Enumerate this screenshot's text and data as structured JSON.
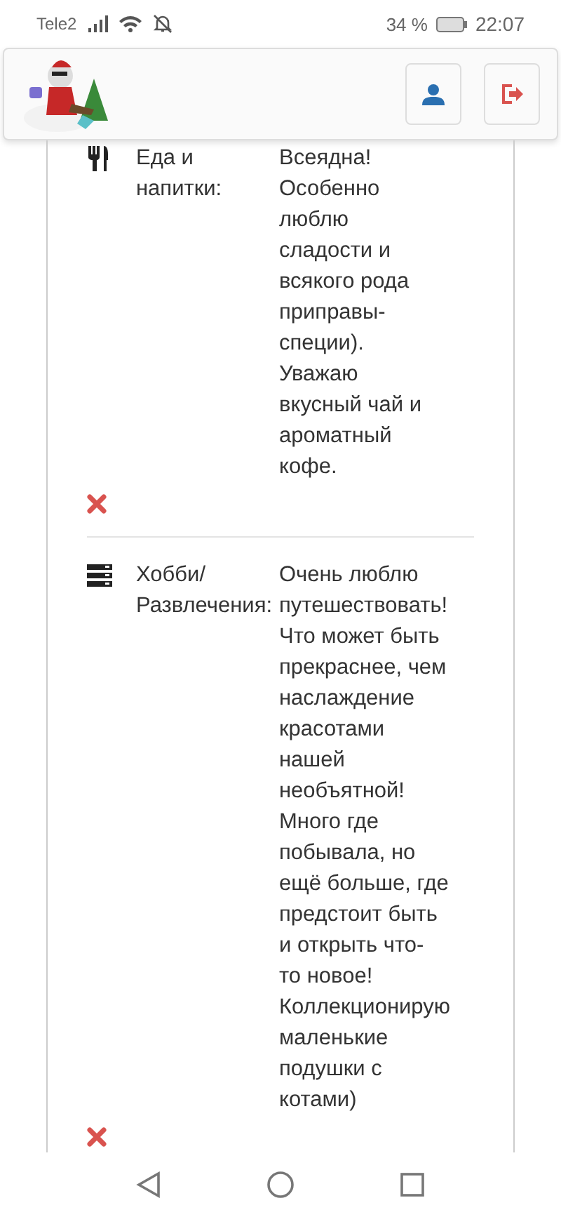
{
  "status_bar": {
    "carrier": "Tele2",
    "battery": "34 %",
    "time": "22:07"
  },
  "header": {
    "buttons": [
      {
        "kind": "profile"
      },
      {
        "kind": "logout"
      }
    ]
  },
  "entries": [
    {
      "kind": "food",
      "label": "Еда и\nнапитки:",
      "text": "Всеядна!\nОсобенно\nлюблю\nсладости и\nвсякого рода\nприправы-\nспеции).\nУважаю\nвкусный чай и\nароматный\nкофе."
    },
    {
      "kind": "hobby",
      "label": "Хобби/\nРазвлечения:",
      "text": "Очень люблю\nпутешествовать!\nЧто может быть\nпрекраснее, чем\nнаслаждение\nкрасотами\nнашей\nнеобъятной!\nМного где\nпобывала, но\nещё больше, где\nпредстоит быть\nи открыть что-\nто новое!\nКоллекционирую\nмаленькие\nподушки с\nкотами)"
    }
  ]
}
